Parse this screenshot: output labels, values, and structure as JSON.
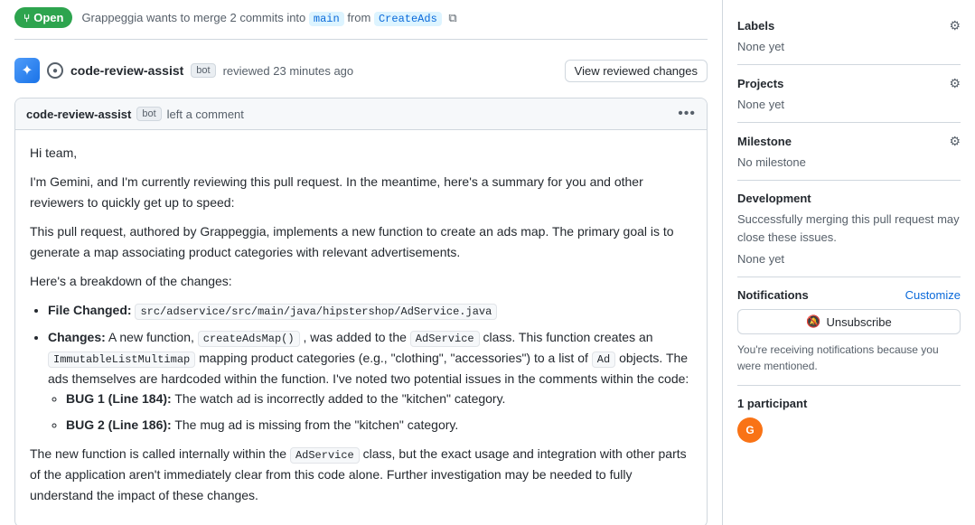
{
  "topbar": {
    "open_label": "Open",
    "merge_text": "Grappeggia wants to merge 2 commits into",
    "branch_main": "main",
    "branch_from": "from",
    "branch_create": "CreateAds"
  },
  "review_header": {
    "reviewer": "code-review-assist",
    "bot_label": "bot",
    "action": "reviewed",
    "time": "23 minutes ago",
    "view_changes_label": "View reviewed changes"
  },
  "comment": {
    "author": "code-review-assist",
    "bot_label": "bot",
    "action": "left a comment",
    "greeting": "Hi team,",
    "intro": "I'm Gemini, and I'm currently reviewing this pull request. In the meantime, here's a summary for you and other reviewers to quickly get up to speed:",
    "summary": "This pull request, authored by Grappeggia, implements a new function to create an ads map. The primary goal is to generate a map associating product categories with relevant advertisements.",
    "breakdown_title": "Here's a breakdown of the changes:",
    "file_changed_label": "File Changed:",
    "file_changed_value": "src/adservice/src/main/java/hipstershop/AdService.java",
    "changes_label": "Changes:",
    "changes_text_1": "A new function,",
    "changes_code_1": "createAdsMap()",
    "changes_text_2": ", was added to the",
    "changes_code_2": "AdService",
    "changes_text_3": "class. This function creates an",
    "changes_code_3": "ImmutableListMultimap",
    "changes_text_4": "mapping product categories (e.g., \"clothing\", \"accessories\") to a list of",
    "changes_code_4": "Ad",
    "changes_text_5": "objects. The ads themselves are hardcoded within the function. I've noted two potential issues in the comments within the code:",
    "bug1_label": "BUG 1 (Line 184):",
    "bug1_text": "The watch ad is incorrectly added to the \"kitchen\" category.",
    "bug2_label": "BUG 2 (Line 186):",
    "bug2_text": "The mug ad is missing from the \"kitchen\" category.",
    "conclusion": "The new function is called internally within the",
    "conclusion_code": "AdService",
    "conclusion_text": "class, but the exact usage and integration with other parts of the application aren't immediately clear from this code alone. Further investigation may be needed to fully understand the impact of these changes."
  },
  "sidebar": {
    "labels_title": "Labels",
    "labels_value": "None yet",
    "projects_title": "Projects",
    "projects_value": "None yet",
    "milestone_title": "Milestone",
    "milestone_value": "No milestone",
    "development_title": "Development",
    "development_text": "Successfully merging this pull request may close these issues.",
    "development_value": "None yet",
    "notifications_title": "Notifications",
    "customize_label": "Customize",
    "unsubscribe_label": "Unsubscribe",
    "notification_info": "You're receiving notifications because you were mentioned.",
    "participants_title": "1 participant"
  }
}
